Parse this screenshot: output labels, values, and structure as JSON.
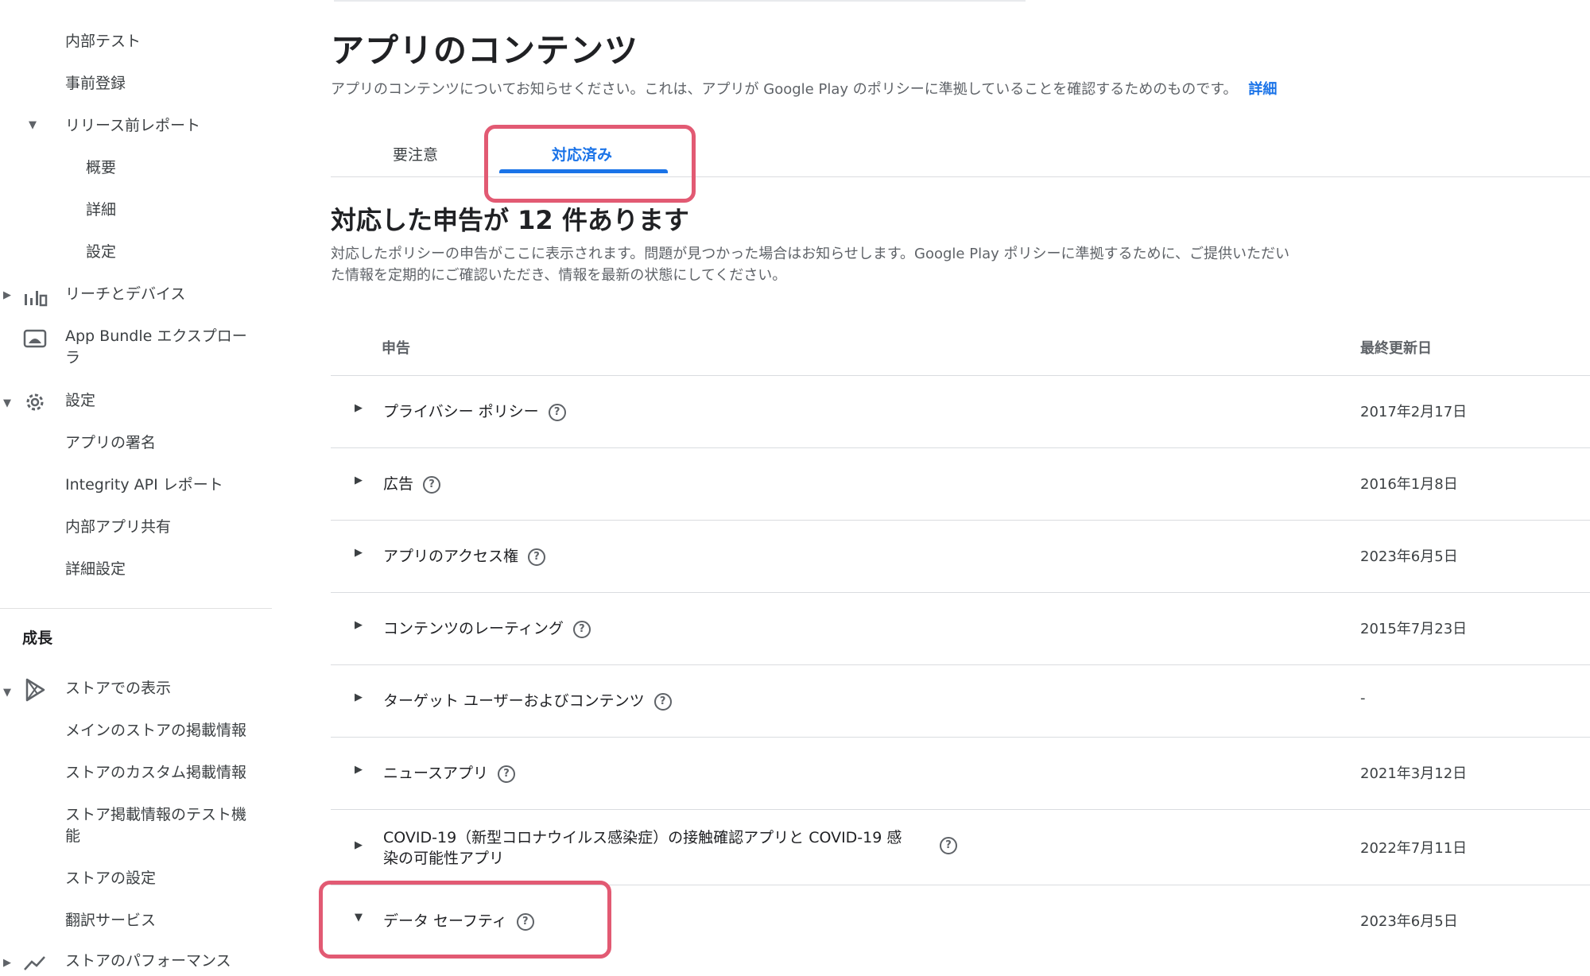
{
  "sidebar": {
    "items": [
      {
        "label": "内部テスト"
      },
      {
        "label": "事前登録"
      },
      {
        "label": "リリース前レポート"
      },
      {
        "label": "概要"
      },
      {
        "label": "詳細"
      },
      {
        "label": "設定"
      },
      {
        "label": "リーチとデバイス"
      },
      {
        "label": "App Bundle エクスプローラ"
      },
      {
        "label": "設定"
      },
      {
        "label": "アプリの署名"
      },
      {
        "label": "Integrity API レポート"
      },
      {
        "label": "内部アプリ共有"
      },
      {
        "label": "詳細設定"
      }
    ],
    "section_growth": "成長",
    "growth_items": [
      {
        "label": "ストアでの表示"
      },
      {
        "label": "メインのストアの掲載情報"
      },
      {
        "label": "ストアのカスタム掲載情報"
      },
      {
        "label": "ストア掲載情報のテスト機能"
      },
      {
        "label": "ストアの設定"
      },
      {
        "label": "翻訳サービス"
      },
      {
        "label": "ストアのパフォーマンス"
      }
    ],
    "icons": {
      "reach": "bar-chart-icon",
      "bundle": "android-icon",
      "settings": "gear-icon",
      "store": "play-store-icon",
      "performance": "trend-icon"
    }
  },
  "main": {
    "title": "アプリのコンテンツ",
    "description": "アプリのコンテンツについてお知らせください。これは、アプリが Google Play のポリシーに準拠していることを確認するためのものです。",
    "details_link": "詳細",
    "tabs": [
      {
        "label": "要注意",
        "active": false
      },
      {
        "label": "対応済み",
        "active": true
      }
    ],
    "section_title": "対応した申告が 12 件あります",
    "section_desc": "対応したポリシーの申告がここに表示されます。問題が見つかった場合はお知らせします。Google Play ポリシーに準拠するために、ご提供いただいた情報を定期的にご確認いただき、情報を最新の状態にしてください。",
    "table": {
      "col_declaration": "申告",
      "col_updated": "最終更新日",
      "rows": [
        {
          "label": "プライバシー ポリシー",
          "date": "2017年2月17日"
        },
        {
          "label": "広告",
          "date": "2016年1月8日"
        },
        {
          "label": "アプリのアクセス権",
          "date": "2023年6月5日"
        },
        {
          "label": "コンテンツのレーティング",
          "date": "2015年7月23日"
        },
        {
          "label": "ターゲット ユーザーおよびコンテンツ",
          "date": "-"
        },
        {
          "label": "ニュースアプリ",
          "date": "2021年3月12日"
        },
        {
          "label": "COVID-19（新型コロナウイルス感染症）の接触確認アプリと COVID-19 感染の可能性アプリ",
          "date": "2022年7月11日"
        },
        {
          "label": "データ セーフティ",
          "date": "2023年6月5日"
        }
      ]
    },
    "accent_color": "#1a73e8",
    "highlight_color": "#e25a73"
  }
}
